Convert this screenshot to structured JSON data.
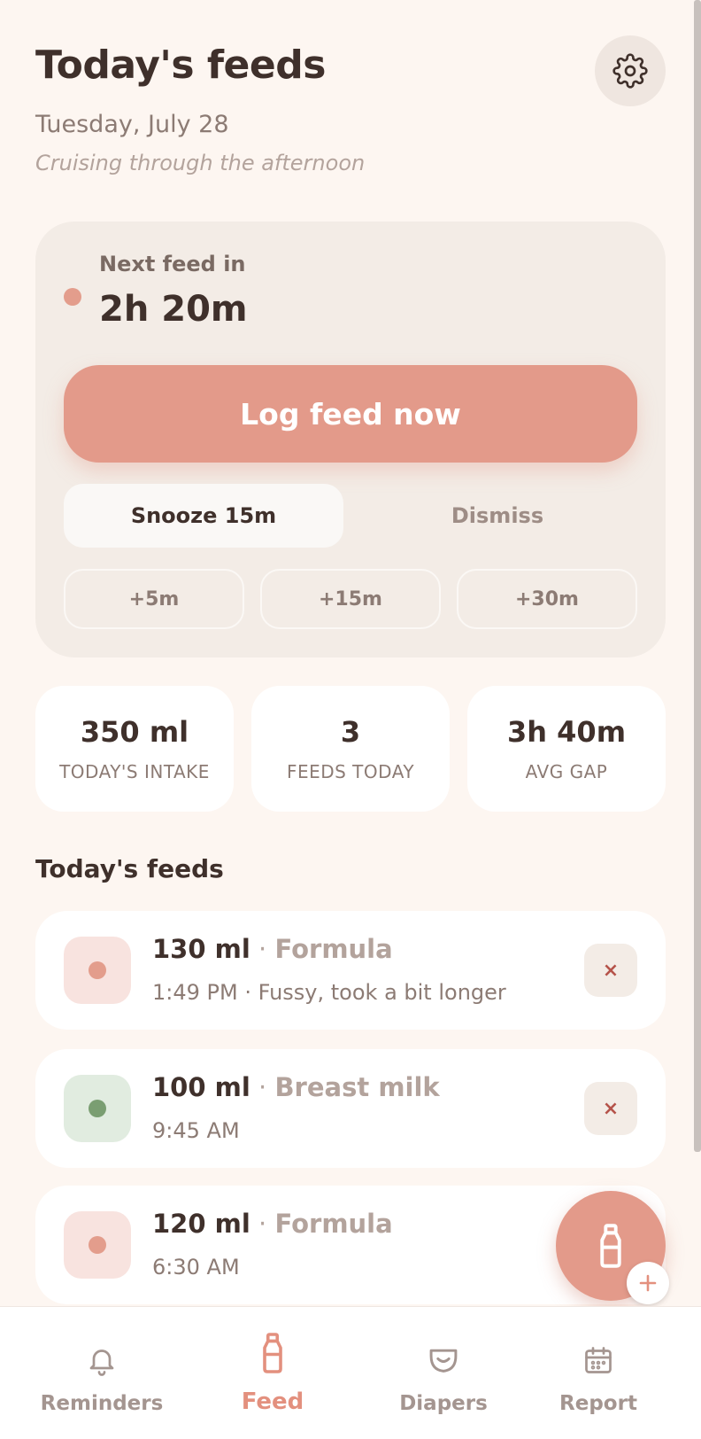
{
  "header": {
    "title": "Today's feeds",
    "date": "Tuesday, July 28",
    "subtitle": "Cruising through the afternoon"
  },
  "next_feed": {
    "label": "Next feed in",
    "value": "2h 20m",
    "log_button": "Log feed now",
    "snooze_button": "Snooze 15m",
    "dismiss_button": "Dismiss",
    "quick_options": [
      "+5m",
      "+15m",
      "+30m"
    ]
  },
  "stats": [
    {
      "value": "350 ml",
      "label": "TODAY'S INTAKE"
    },
    {
      "value": "3",
      "label": "FEEDS TODAY"
    },
    {
      "value": "3h 40m",
      "label": "AVG GAP"
    }
  ],
  "feeds_section": {
    "title": "Today's feeds",
    "items": [
      {
        "amount": "130 ml",
        "type": "Formula",
        "detail": "1:49 PM · Fussy, took a bit longer",
        "color": "#e39d8c",
        "bg": "#f8e3df"
      },
      {
        "amount": "100 ml",
        "type": "Breast milk",
        "detail": "9:45 AM",
        "color": "#7a9e72",
        "bg": "#e1ece0"
      },
      {
        "amount": "120 ml",
        "type": "Formula",
        "detail": "6:30 AM",
        "color": "#e39d8c",
        "bg": "#f8e3df"
      }
    ],
    "separator": "·",
    "delete_glyph": "×"
  },
  "tabs": [
    {
      "label": "Reminders",
      "icon": "bell-icon"
    },
    {
      "label": "Feed",
      "icon": "bottle-icon"
    },
    {
      "label": "Diapers",
      "icon": "diaper-icon"
    },
    {
      "label": "Report",
      "icon": "calendar-icon"
    }
  ],
  "colors": {
    "accent": "#e39a8a",
    "background": "#fdf6f1",
    "card": "#f3ece6",
    "text": "#3f302b",
    "muted": "#8c7b74"
  }
}
